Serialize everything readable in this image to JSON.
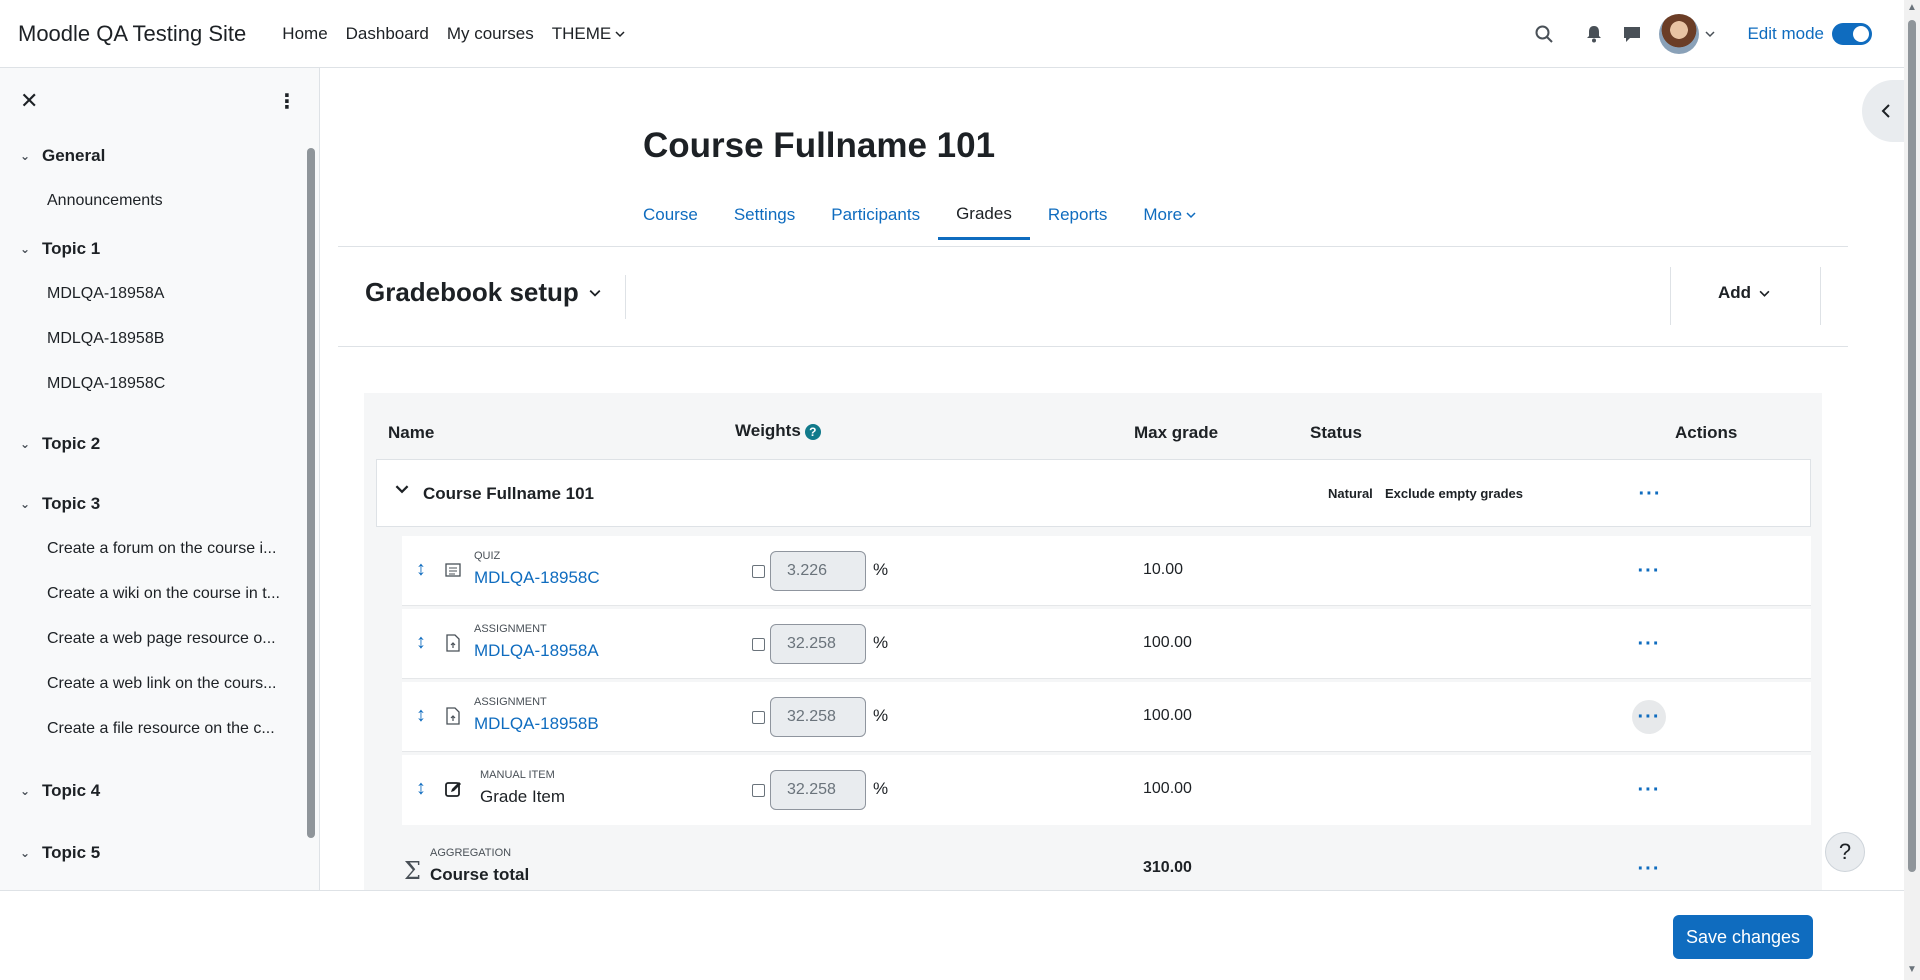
{
  "navbar": {
    "brand": "Moodle QA Testing Site",
    "items": [
      {
        "label": "Home"
      },
      {
        "label": "Dashboard"
      },
      {
        "label": "My courses"
      },
      {
        "label": "THEME"
      }
    ],
    "edit_mode_label": "Edit mode",
    "edit_mode_on": true,
    "icons": [
      "search-icon",
      "bell-icon",
      "chat-icon",
      "avatar",
      "chevron-down-icon"
    ]
  },
  "drawer": {
    "sections": [
      {
        "title": "General",
        "items": [
          "Announcements"
        ]
      },
      {
        "title": "Topic 1",
        "items": [
          "MDLQA-18958A",
          "MDLQA-18958B",
          "MDLQA-18958C"
        ]
      },
      {
        "title": "Topic 2",
        "items": []
      },
      {
        "title": "Topic 3",
        "items": [
          "Create a forum on the course i...",
          "Create a wiki on the course in t...",
          "Create a web page resource o...",
          "Create a web link on the cours...",
          "Create a file resource on the c..."
        ]
      },
      {
        "title": "Topic 4",
        "items": []
      },
      {
        "title": "Topic 5",
        "items": []
      }
    ]
  },
  "page": {
    "title": "Course Fullname 101",
    "tabs": [
      {
        "label": "Course"
      },
      {
        "label": "Settings"
      },
      {
        "label": "Participants"
      },
      {
        "label": "Grades",
        "active": true
      },
      {
        "label": "Reports"
      },
      {
        "label": "More"
      }
    ],
    "tertiary_title": "Gradebook setup",
    "add_label": "Add"
  },
  "table": {
    "headers": {
      "name": "Name",
      "weights": "Weights",
      "max_grade": "Max grade",
      "status": "Status",
      "actions": "Actions"
    },
    "category": {
      "name": "Course Fullname 101",
      "badges": [
        "Natural",
        "Exclude empty grades"
      ]
    },
    "items": [
      {
        "kind": "QUIZ",
        "name": "MDLQA-18958C",
        "weight": "3.226",
        "max": "10.00",
        "link": true
      },
      {
        "kind": "ASSIGNMENT",
        "name": "MDLQA-18958A",
        "weight": "32.258",
        "max": "100.00",
        "link": true
      },
      {
        "kind": "ASSIGNMENT",
        "name": "MDLQA-18958B",
        "weight": "32.258",
        "max": "100.00",
        "link": true
      },
      {
        "kind": "MANUAL ITEM",
        "name": "Grade Item",
        "weight": "32.258",
        "max": "100.00",
        "link": false
      }
    ],
    "percent_symbol": "%",
    "total": {
      "kind": "AGGREGATION",
      "name": "Course total",
      "max": "310.00"
    }
  },
  "footer": {
    "save_label": "Save changes"
  },
  "help_label": "?",
  "colors": {
    "accent": "#0f6cbf",
    "help_badge": "#117a8b"
  }
}
